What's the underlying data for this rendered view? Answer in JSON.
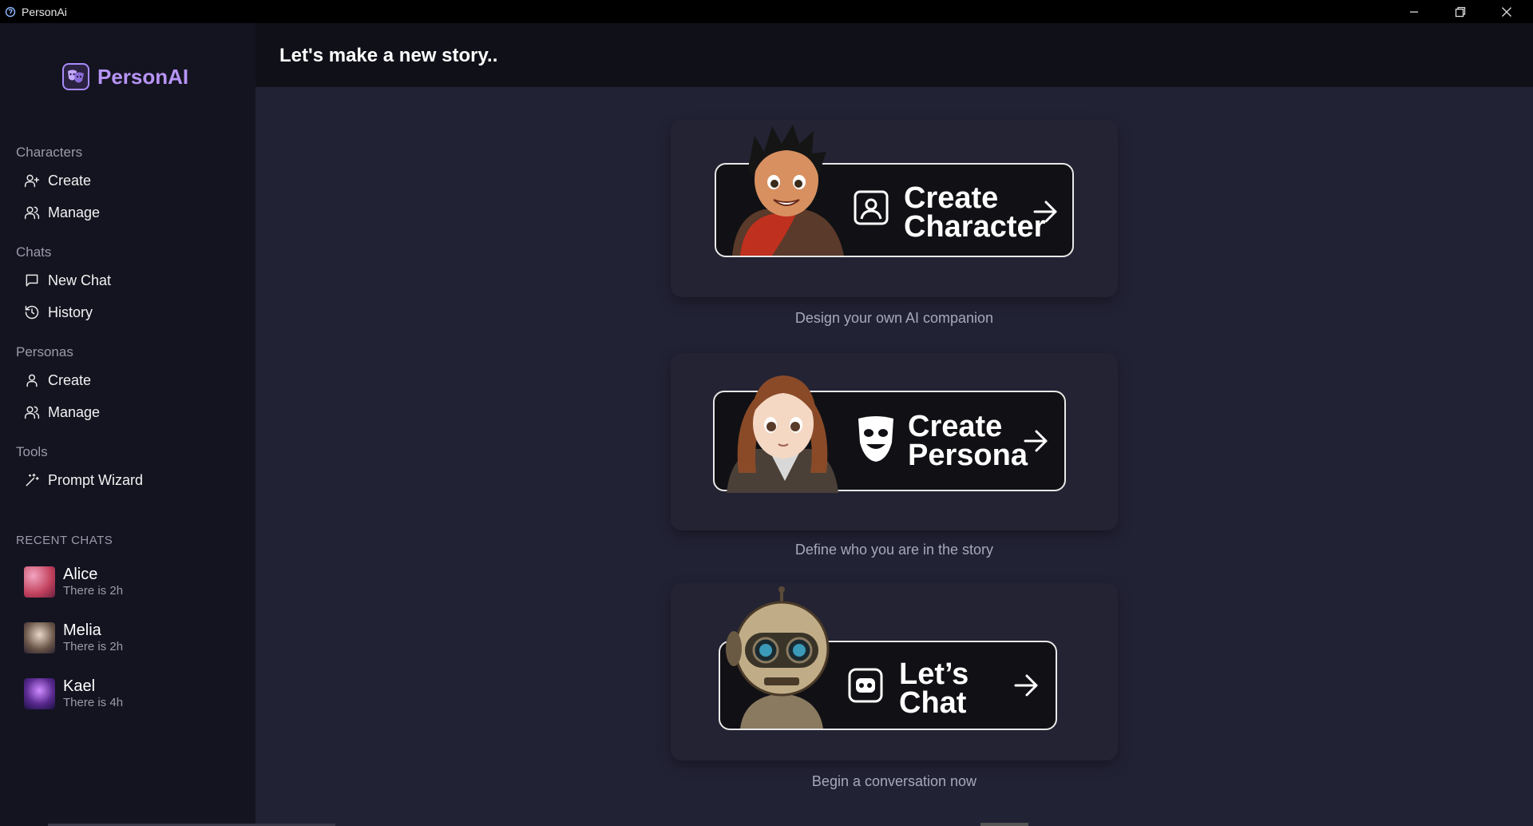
{
  "window": {
    "title": "PersonAi"
  },
  "sidebar": {
    "logo_text": "PersonAI",
    "sections": [
      {
        "title": "Characters",
        "items": [
          {
            "label": "Create",
            "icon": "user-plus-icon"
          },
          {
            "label": "Manage",
            "icon": "users-icon"
          }
        ]
      },
      {
        "title": "Chats",
        "items": [
          {
            "label": "New Chat",
            "icon": "message-square-icon"
          },
          {
            "label": "History",
            "icon": "history-icon"
          }
        ]
      },
      {
        "title": "Personas",
        "items": [
          {
            "label": "Create",
            "icon": "user-icon"
          },
          {
            "label": "Manage",
            "icon": "users-icon"
          }
        ]
      },
      {
        "title": "Tools",
        "items": [
          {
            "label": "Prompt Wizard",
            "icon": "wand-icon"
          }
        ]
      }
    ],
    "recent_header": "RECENT CHATS",
    "recent": [
      {
        "name": "Alice",
        "time": "There is 2h"
      },
      {
        "name": "Melia",
        "time": "There is 2h"
      },
      {
        "name": "Kael",
        "time": "There is 4h"
      }
    ]
  },
  "header": {
    "title": "Let's make a new story.."
  },
  "actions": [
    {
      "line1": "Create",
      "line2": "Character",
      "caption": "Design your own AI companion"
    },
    {
      "line1": "Create",
      "line2": "Persona",
      "caption": "Define who you are in the story"
    },
    {
      "line1": "Let’s",
      "line2": "Chat",
      "caption": "Begin a conversation now"
    }
  ],
  "colors": {
    "accent": "#b794f6",
    "sidebar_bg": "#141420",
    "main_bg": "#222235",
    "header_bg": "#101018"
  }
}
